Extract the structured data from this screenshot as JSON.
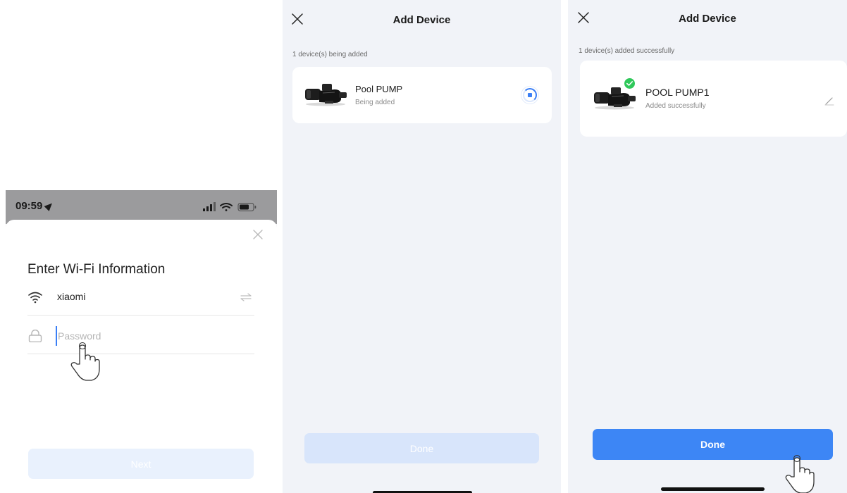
{
  "colors": {
    "accent": "#3d86f5",
    "success": "#2fc85a",
    "disabled_button": "#d8e5fb",
    "background": "#f1f3f8"
  },
  "wifi_screen": {
    "status_bar": {
      "time": "09:59",
      "icons": [
        "location-arrow-icon",
        "cellular-signal-icon",
        "wifi-icon",
        "battery-icon"
      ]
    },
    "title": "Enter Wi-Fi Information",
    "ssid": {
      "value": "xiaomi",
      "icon": "wifi-icon",
      "action_icon": "swap-icon"
    },
    "password": {
      "placeholder": "Password",
      "value": "",
      "icon": "lock-icon"
    },
    "next_label": "Next",
    "close_icon": "close-icon"
  },
  "adding_screen": {
    "title": "Add Device",
    "status_line": "1 device(s) being added",
    "device": {
      "name": "Pool PUMP",
      "status": "Being added",
      "indicator_icon": "loading-spinner-icon"
    },
    "done_label": "Done",
    "done_enabled": false
  },
  "done_screen": {
    "title": "Add Device",
    "status_line": "1 device(s) added successfully",
    "device": {
      "name": "POOL PUMP1",
      "status": "Added successfully",
      "badge_icon": "check-badge-icon",
      "action_icon": "edit-pencil-icon"
    },
    "done_label": "Done",
    "done_enabled": true
  }
}
